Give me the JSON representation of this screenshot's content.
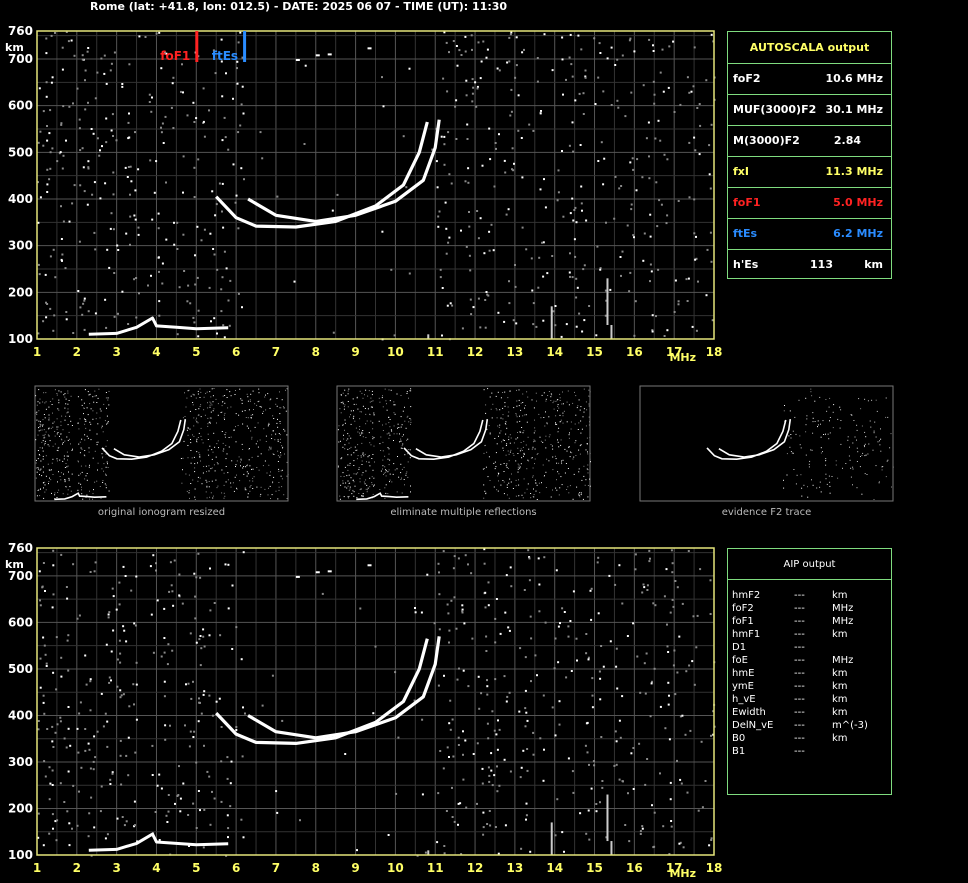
{
  "header": {
    "title": "Rome (lat: +41.8, lon: 012.5) - DATE: 2025 06 07 - TIME (UT): 11:30"
  },
  "chart_data": [
    {
      "type": "scatter",
      "name": "main ionogram",
      "xlim": [
        1,
        18
      ],
      "ylim": [
        100,
        760
      ],
      "x_ticks": [
        "1",
        "2",
        "3",
        "4",
        "5",
        "6",
        "7",
        "8",
        "9",
        "10",
        "11",
        "12",
        "13",
        "14",
        "15",
        "16",
        "17",
        "18"
      ],
      "y_ticks": [
        "100",
        "200",
        "300",
        "400",
        "500",
        "600",
        "700",
        "760"
      ],
      "xunit": "MHz",
      "yunit": "km",
      "markers": [
        {
          "label": "foF1",
          "x": 5.0,
          "color": "#ff2222"
        },
        {
          "label": "ftEs",
          "x": 6.2,
          "color": "#2a8cff"
        }
      ],
      "traces": [
        {
          "color": "#ffffff",
          "points": [
            [
              5.5,
              405
            ],
            [
              6.0,
              360
            ],
            [
              6.5,
              342
            ],
            [
              7.5,
              340
            ],
            [
              8.5,
              352
            ],
            [
              9.5,
              385
            ],
            [
              10.2,
              430
            ],
            [
              10.6,
              500
            ],
            [
              10.8,
              565
            ]
          ]
        },
        {
          "color": "#ffffff",
          "points": [
            [
              6.3,
              400
            ],
            [
              7.0,
              365
            ],
            [
              8.0,
              352
            ],
            [
              9.0,
              365
            ],
            [
              10.0,
              395
            ],
            [
              10.7,
              440
            ],
            [
              11.0,
              510
            ],
            [
              11.1,
              570
            ]
          ]
        },
        {
          "color": "#ffffff",
          "points": [
            [
              2.3,
              110
            ],
            [
              3.0,
              112
            ],
            [
              3.5,
              125
            ],
            [
              3.9,
              145
            ],
            [
              4.0,
              128
            ],
            [
              4.5,
              125
            ],
            [
              5.0,
              122
            ],
            [
              5.8,
              124
            ]
          ]
        }
      ]
    },
    {
      "type": "scatter",
      "name": "AIP ionogram",
      "xlim": [
        1,
        18
      ],
      "ylim": [
        100,
        760
      ],
      "x_ticks": [
        "1",
        "2",
        "3",
        "4",
        "5",
        "6",
        "7",
        "8",
        "9",
        "10",
        "11",
        "12",
        "13",
        "14",
        "15",
        "16",
        "17",
        "18"
      ],
      "y_ticks": [
        "100",
        "200",
        "300",
        "400",
        "500",
        "600",
        "700",
        "760"
      ],
      "xunit": "MHz",
      "yunit": "km",
      "traces": [
        {
          "color": "#ffffff",
          "points": [
            [
              5.5,
              405
            ],
            [
              6.0,
              360
            ],
            [
              6.5,
              342
            ],
            [
              7.5,
              340
            ],
            [
              8.5,
              352
            ],
            [
              9.5,
              385
            ],
            [
              10.2,
              430
            ],
            [
              10.6,
              500
            ],
            [
              10.8,
              565
            ]
          ]
        },
        {
          "color": "#ffffff",
          "points": [
            [
              6.3,
              400
            ],
            [
              7.0,
              365
            ],
            [
              8.0,
              352
            ],
            [
              9.0,
              365
            ],
            [
              10.0,
              395
            ],
            [
              10.7,
              440
            ],
            [
              11.0,
              510
            ],
            [
              11.1,
              570
            ]
          ]
        },
        {
          "color": "#ffffff",
          "points": [
            [
              2.3,
              110
            ],
            [
              3.0,
              112
            ],
            [
              3.5,
              125
            ],
            [
              3.9,
              145
            ],
            [
              4.0,
              128
            ],
            [
              4.5,
              125
            ],
            [
              5.0,
              122
            ],
            [
              5.8,
              124
            ]
          ]
        }
      ]
    }
  ],
  "thumbnails": [
    {
      "caption": "original ionogram resized"
    },
    {
      "caption": "eliminate multiple reflections"
    },
    {
      "caption": "evidence F2 trace"
    }
  ],
  "autoscala": {
    "title": "AUTOSCALA output",
    "rows": [
      {
        "param": "foF2",
        "value": "10.6 MHz",
        "color": "#ffffff"
      },
      {
        "param": "MUF(3000)F2",
        "value": "30.1 MHz",
        "color": "#ffffff"
      },
      {
        "param": "M(3000)F2",
        "value": "2.84",
        "color": "#ffffff"
      },
      {
        "param": "fxI",
        "value": "11.3 MHz",
        "color": "#ffff66"
      },
      {
        "param": "foF1",
        "value": "5.0 MHz",
        "color": "#ff2222"
      },
      {
        "param": "ftEs",
        "value": "6.2 MHz",
        "color": "#2a8cff"
      },
      {
        "param": "h'Es",
        "value": "113",
        "unit": "km",
        "color": "#ffffff"
      }
    ]
  },
  "aip": {
    "title": "AIP output",
    "rows": [
      {
        "param": "hmF2",
        "value": "---",
        "unit": "km"
      },
      {
        "param": "foF2",
        "value": "---",
        "unit": "MHz"
      },
      {
        "param": "foF1",
        "value": "---",
        "unit": "MHz"
      },
      {
        "param": "hmF1",
        "value": "---",
        "unit": "km"
      },
      {
        "param": "D1",
        "value": "---",
        "unit": ""
      },
      {
        "param": "foE",
        "value": "---",
        "unit": "MHz"
      },
      {
        "param": "hmE",
        "value": "---",
        "unit": "km"
      },
      {
        "param": "ymE",
        "value": "---",
        "unit": "km"
      },
      {
        "param": "h_vE",
        "value": "---",
        "unit": "km"
      },
      {
        "param": "Ewidth",
        "value": "---",
        "unit": "km"
      },
      {
        "param": "DelN_vE",
        "value": "---",
        "unit": "m^(-3)"
      },
      {
        "param": "B0",
        "value": "---",
        "unit": "km"
      },
      {
        "param": "B1",
        "value": "---",
        "unit": ""
      }
    ]
  }
}
